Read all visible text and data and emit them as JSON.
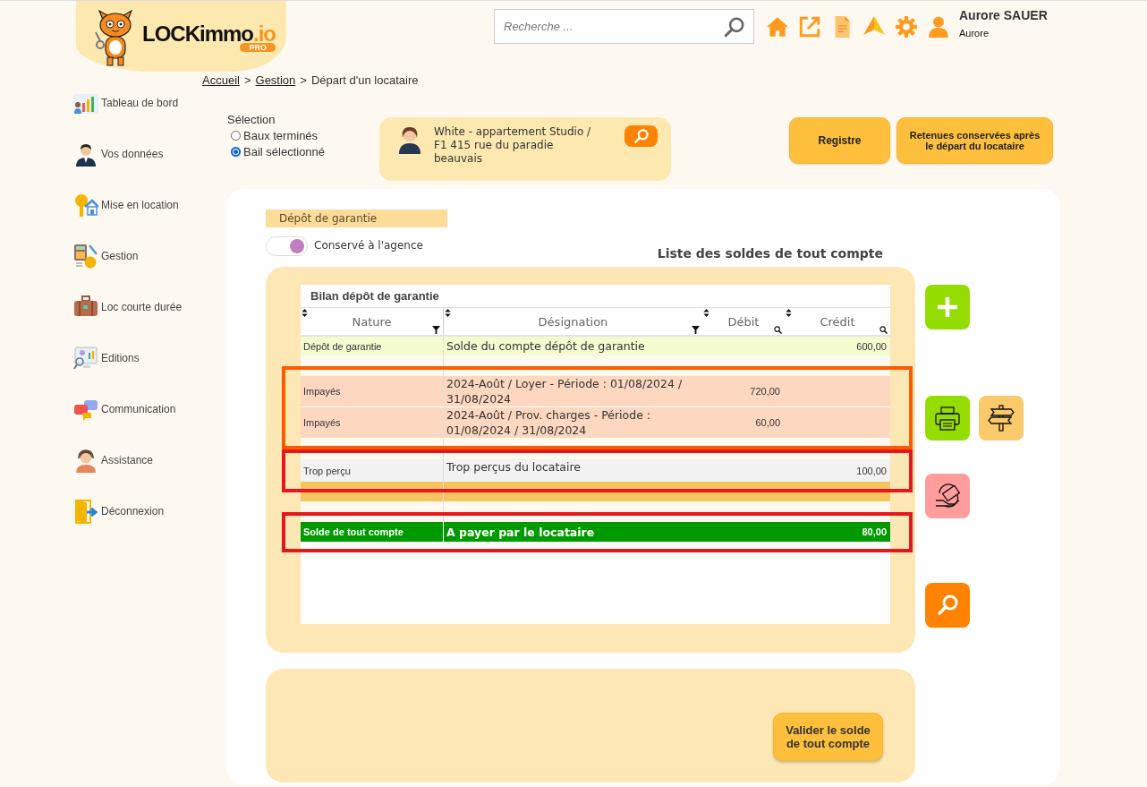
{
  "header": {
    "logo": {
      "name": "LOCKimmo",
      "domain": ".io",
      "badge": "PRO"
    },
    "search": {
      "placeholder": "Recherche ..."
    },
    "toolbar": [
      {
        "kind": "home"
      },
      {
        "kind": "external"
      },
      {
        "kind": "document"
      },
      {
        "kind": "plane"
      },
      {
        "kind": "settings"
      },
      {
        "kind": "user"
      }
    ],
    "user": {
      "name": "Aurore SAUER",
      "login": "Aurore"
    }
  },
  "sidebar": {
    "items": [
      {
        "label": "Tableau de bord",
        "kind": "chart"
      },
      {
        "label": "Vos données",
        "kind": "person"
      },
      {
        "label": "Mise en location",
        "kind": "key"
      },
      {
        "label": "Gestion",
        "kind": "calculator"
      },
      {
        "label": "Loc courte durée",
        "kind": "suitcase"
      },
      {
        "label": "Editions",
        "kind": "monitor"
      },
      {
        "label": "Communication",
        "kind": "chat"
      },
      {
        "label": "Assistance",
        "kind": "headset"
      },
      {
        "label": "Déconnexion",
        "kind": "exit"
      }
    ]
  },
  "breadcrumb": [
    {
      "label": "Accueil",
      "kind": "link"
    },
    {
      "label": ">",
      "kind": "separator"
    },
    {
      "label": "Gestion",
      "kind": "link"
    },
    {
      "label": ">",
      "kind": "separator"
    },
    {
      "label": "Départ d'un locataire",
      "kind": "current"
    }
  ],
  "selection": {
    "label": "Sélection",
    "options": [
      {
        "label": "Baux terminés",
        "selected": false
      },
      {
        "label": "Bail sélectionné",
        "selected": true
      }
    ]
  },
  "tenant": {
    "text": "White - appartement Studio / F1 415 rue du paradie beauvais"
  },
  "actions": [
    {
      "label": "Registre"
    },
    {
      "label": "Retenues conservées après le départ du locataire"
    }
  ],
  "deposit": {
    "label": "Dépôt de garantie",
    "toggle": {
      "label": "Conservé à l'agence",
      "on": true
    }
  },
  "list_title": "Liste des soldes de tout compte",
  "table": {
    "title": "Bilan dépôt de garantie",
    "columns": [
      {
        "label": "Nature",
        "kind": "funnel"
      },
      {
        "label": "Désignation",
        "kind": "funnel"
      },
      {
        "label": "Débit",
        "kind": "search"
      },
      {
        "label": "Crédit",
        "kind": "search"
      }
    ],
    "rows": [
      {
        "kind": "deposit",
        "nature": "Dépôt de garantie",
        "designation": "Solde du compte dépôt de garantie",
        "credit": "600,00"
      },
      {
        "kind": "spacer"
      },
      {
        "kind": "unpaid",
        "nature": "Impayés",
        "designation": "2024-Août / Loyer - Période : 01/08/2024 / 31/08/2024",
        "debit": "720,00",
        "color": "#ff5a00"
      },
      {
        "kind": "unpaid",
        "nature": "Impayés",
        "designation": "2024-Août / Prov. charges - Période : 01/08/2024 / 31/08/2024",
        "debit": "60,00",
        "color": "#ff5a00"
      },
      {
        "kind": "spacer"
      },
      {
        "kind": "overpaid",
        "nature": "Trop perçu",
        "designation": "Trop perçus du locataire",
        "credit": "100,00",
        "color": "#e8161c"
      },
      {
        "kind": "band"
      },
      {
        "kind": "spacer"
      },
      {
        "kind": "total",
        "nature": "Solde de tout compte",
        "designation": "A payer par le locataire",
        "credit": "80,00",
        "color": "#e8161c"
      }
    ]
  },
  "side_buttons": [
    {
      "buttons": [
        {
          "kind": "add"
        }
      ]
    },
    {
      "buttons": [
        {
          "kind": "print"
        },
        {
          "kind": "signpost"
        }
      ]
    },
    {
      "buttons": [
        {
          "kind": "refund"
        }
      ]
    },
    {
      "buttons": [
        {
          "kind": "search"
        }
      ]
    }
  ],
  "validate": {
    "label": "Valider le solde de tout compte"
  }
}
